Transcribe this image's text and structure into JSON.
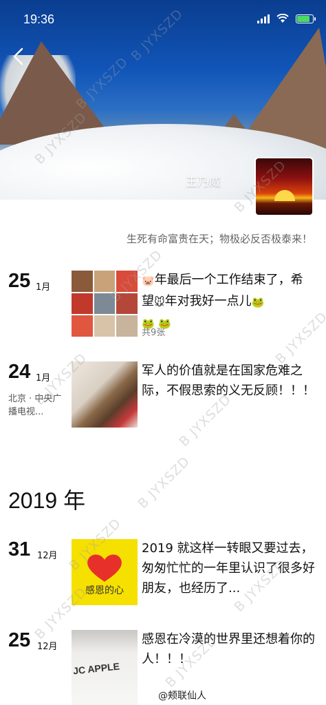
{
  "status": {
    "time": "19:36"
  },
  "profile": {
    "name": "王乃威",
    "signature": "生死有命富贵在天；物极必反否极泰来！"
  },
  "feed": [
    {
      "day": "25",
      "month": "1月",
      "text_parts": [
        "年最后一个工作结束了，希望",
        "年对我好一点儿"
      ],
      "icon_pig": "pig-icon",
      "icon_mouse": "mouse-icon",
      "icon_frog": "frog-icon",
      "photo_count": "共9张"
    },
    {
      "day": "24",
      "month": "1月",
      "location": "北京 · 中央广播电视...",
      "text": "军人的价值就是在国家危难之际，不假思索的义无反顾！！！"
    }
  ],
  "year_header": "2019 年",
  "feed_2019": [
    {
      "day": "31",
      "month": "12月",
      "text": "2019 就这样一转眼又要过去，匆匆忙忙的一年里认识了很多好朋友，也经历了...",
      "image_text": "感恩的心"
    },
    {
      "day": "25",
      "month": "12月",
      "text": "感恩在冷漠的世界里还想着你的人！！！",
      "image_text": "JC APPLE"
    }
  ],
  "watermark": "B JYXSZD",
  "footer": "@颊联仙人"
}
